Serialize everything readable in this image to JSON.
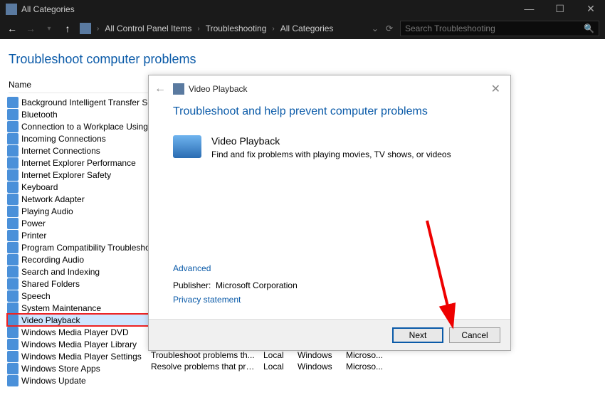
{
  "titlebar": {
    "title": "All Categories"
  },
  "nav": {
    "path": [
      "All Control Panel Items",
      "Troubleshooting",
      "All Categories"
    ],
    "search_placeholder": "Search Troubleshooting"
  },
  "page": {
    "title": "Troubleshoot computer problems",
    "col_header": "Name"
  },
  "sidebar": {
    "items": [
      "Background Intelligent Transfer Service",
      "Bluetooth",
      "Connection to a Workplace Using Dire...",
      "Incoming Connections",
      "Internet Connections",
      "Internet Explorer Performance",
      "Internet Explorer Safety",
      "Keyboard",
      "Network Adapter",
      "Playing Audio",
      "Power",
      "Printer",
      "Program Compatibility Troubleshooter",
      "Recording Audio",
      "Search and Indexing",
      "Shared Folders",
      "Speech",
      "System Maintenance",
      "Video Playback",
      "Windows Media Player DVD",
      "Windows Media Player Library",
      "Windows Media Player Settings",
      "Windows Store Apps",
      "Windows Update"
    ],
    "selected_index": 18
  },
  "grid": {
    "rows": [
      [
        "Troubleshoot problems th...",
        "Local",
        "Windows",
        "Microso..."
      ],
      [
        "Resolve problems that pre...",
        "Local",
        "Windows",
        "Microso..."
      ]
    ]
  },
  "dialog": {
    "header_title": "Video Playback",
    "title": "Troubleshoot and help prevent computer problems",
    "item_title": "Video Playback",
    "item_desc": "Find and fix problems with playing movies, TV shows, or videos",
    "advanced": "Advanced",
    "publisher_label": "Publisher:",
    "publisher_value": "Microsoft Corporation",
    "privacy": "Privacy statement",
    "next": "Next",
    "cancel": "Cancel"
  }
}
